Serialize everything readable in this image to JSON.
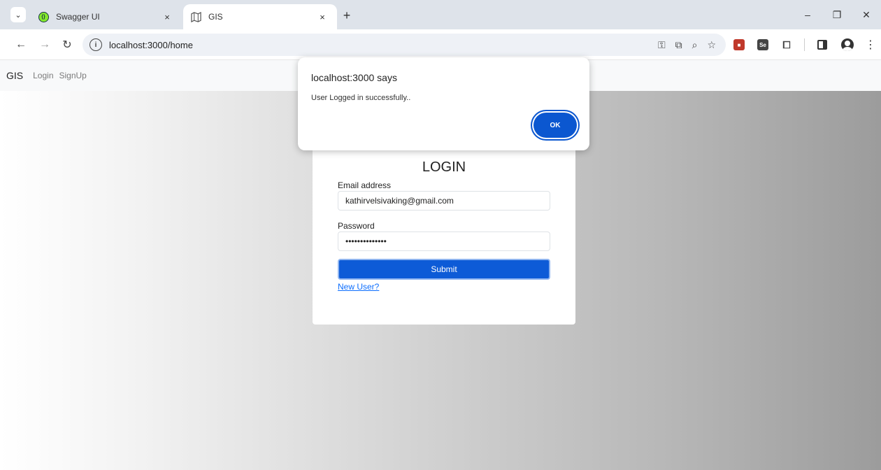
{
  "browser": {
    "tabs": [
      {
        "title": "Swagger UI",
        "icon": "swagger-icon",
        "active": false
      },
      {
        "title": "GIS",
        "icon": "map-icon",
        "active": true
      }
    ],
    "tab_close_glyph": "×",
    "new_tab_glyph": "+",
    "address": "localhost:3000/home",
    "window_controls": {
      "minimize": "–",
      "restore": "❐",
      "close": "✕"
    }
  },
  "app": {
    "brand": "GIS",
    "nav": [
      {
        "label": "Login"
      },
      {
        "label": "SignUp"
      }
    ]
  },
  "login_form": {
    "title": "LOGIN",
    "email_label": "Email address",
    "email_value": "kathirvelsivaking@gmail.com",
    "password_label": "Password",
    "password_value": "••••••••••••••",
    "submit_label": "Submit",
    "new_user_link": "New User?"
  },
  "alert": {
    "title": "localhost:3000 says",
    "message": "User Logged in successfully..",
    "ok_label": "OK"
  },
  "colors": {
    "primary_button": "#0d5bd7",
    "dialog_ok": "#0b57d0",
    "link": "#0d6efd"
  }
}
